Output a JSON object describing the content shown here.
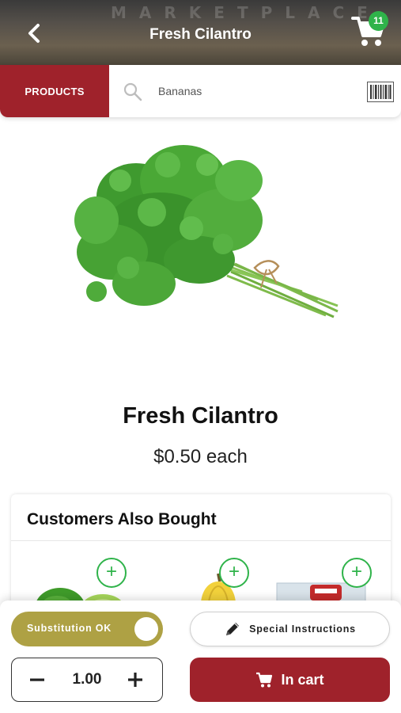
{
  "header": {
    "title": "Fresh Cilantro",
    "background_lettering": "MARKETPLACE",
    "cart_count": "11"
  },
  "search": {
    "products_label": "PRODUCTS",
    "placeholder": "Bananas"
  },
  "product": {
    "name": "Fresh Cilantro",
    "price": "$0.50 each"
  },
  "also_bought": {
    "title": "Customers Also Bought",
    "add_label": "+"
  },
  "bottom": {
    "substitution_label": "Substitution OK",
    "substitution_on": true,
    "special_instructions_label": "Special Instructions",
    "quantity": "1.00",
    "in_cart_label": "In cart"
  },
  "colors": {
    "brand_red": "#9f222b",
    "toggle_olive": "#aea144",
    "add_green": "#2fb34a"
  }
}
